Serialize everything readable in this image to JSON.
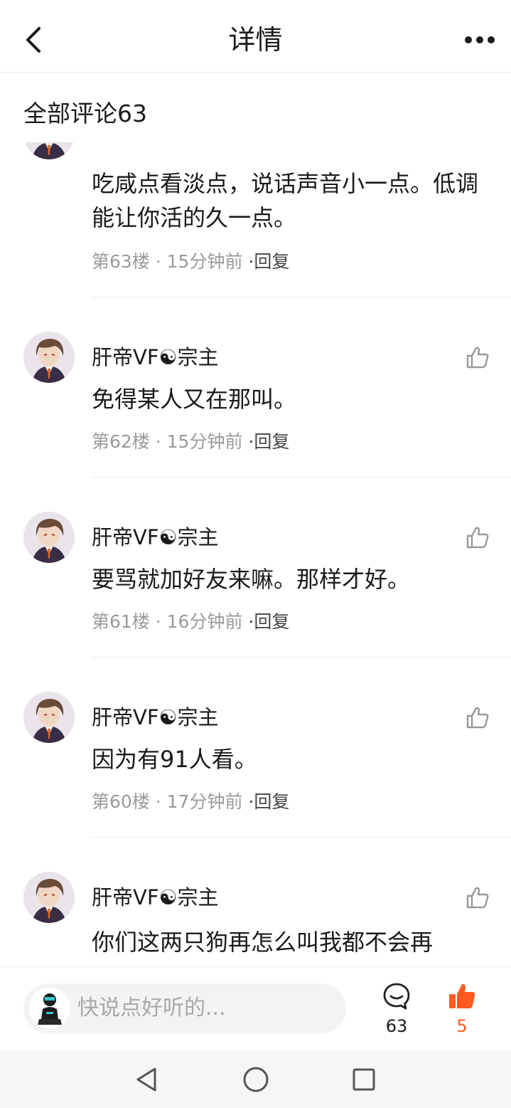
{
  "header": {
    "title": "详情"
  },
  "section": {
    "title": "全部评论63"
  },
  "comments": [
    {
      "name": "",
      "text": "吃咸点看淡点，说话声音小一点。低调能让你活的久一点。",
      "floor": "第63楼",
      "time": "15分钟前",
      "reply": "回复"
    },
    {
      "name": "肝帝VF☯宗主",
      "text": "免得某人又在那叫。",
      "floor": "第62楼",
      "time": "15分钟前",
      "reply": "回复"
    },
    {
      "name": "肝帝VF☯宗主",
      "text": "要骂就加好友来嘛。那样才好。",
      "floor": "第61楼",
      "time": "16分钟前",
      "reply": "回复"
    },
    {
      "name": "肝帝VF☯宗主",
      "text": "因为有91人看。",
      "floor": "第60楼",
      "time": "17分钟前",
      "reply": "回复"
    },
    {
      "name": "肝帝VF☯宗主",
      "text": "你们这两只狗再怎么叫我都不会再",
      "floor": "",
      "time": "",
      "reply": ""
    }
  ],
  "meta_separator": " · ",
  "reply_prefix": "·",
  "bottom_bar": {
    "input_placeholder": "快说点好听的...",
    "comment_count": "63",
    "like_count": "5"
  },
  "colors": {
    "text": "#1a1a1a",
    "meta": "#9a9a9a",
    "accent_like": "#ff5a1f",
    "divider": "#ececec"
  },
  "icons": {
    "back": "chevron-left-icon",
    "more": "more-dots-icon",
    "like": "thumbs-up-icon",
    "comment": "comment-bubble-icon",
    "nav_back": "triangle-back-icon",
    "nav_home": "circle-home-icon",
    "nav_recent": "square-recent-icon"
  }
}
